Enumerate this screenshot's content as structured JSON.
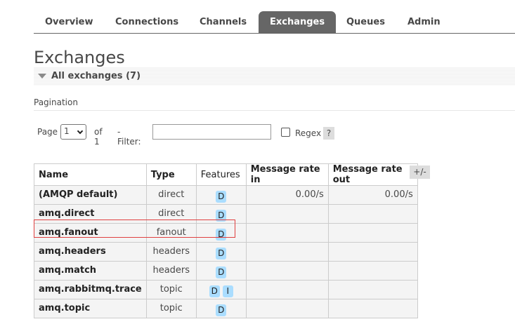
{
  "tabs": [
    {
      "label": "Overview"
    },
    {
      "label": "Connections"
    },
    {
      "label": "Channels"
    },
    {
      "label": "Exchanges",
      "active": true
    },
    {
      "label": "Queues"
    },
    {
      "label": "Admin"
    }
  ],
  "page_title": "Exchanges",
  "section_label": "All exchanges (7)",
  "pagination": {
    "title": "Pagination",
    "page_label": "Page",
    "page_value": "1",
    "of_label": "of 1",
    "filter_label": "- Filter:",
    "filter_value": "",
    "regex_label": "Regex",
    "help_label": "?"
  },
  "table": {
    "columns": [
      "Name",
      "Type",
      "Features",
      "Message rate in",
      "Message rate out"
    ],
    "toggle_label": "+/-",
    "rows": [
      {
        "name": "(AMQP default)",
        "type": "direct",
        "features": [
          "D"
        ],
        "rate_in": "0.00/s",
        "rate_out": "0.00/s"
      },
      {
        "name": "amq.direct",
        "type": "direct",
        "features": [
          "D"
        ],
        "rate_in": "",
        "rate_out": ""
      },
      {
        "name": "amq.fanout",
        "type": "fanout",
        "features": [
          "D"
        ],
        "rate_in": "",
        "rate_out": ""
      },
      {
        "name": "amq.headers",
        "type": "headers",
        "features": [
          "D"
        ],
        "rate_in": "",
        "rate_out": ""
      },
      {
        "name": "amq.match",
        "type": "headers",
        "features": [
          "D"
        ],
        "rate_in": "",
        "rate_out": ""
      },
      {
        "name": "amq.rabbitmq.trace",
        "type": "topic",
        "features": [
          "D",
          "I"
        ],
        "rate_in": "",
        "rate_out": ""
      },
      {
        "name": "amq.topic",
        "type": "topic",
        "features": [
          "D"
        ],
        "rate_in": "",
        "rate_out": ""
      }
    ]
  },
  "colors": {
    "active_tab": "#666666",
    "badge": "#aaddff",
    "highlight": "#e04040"
  }
}
